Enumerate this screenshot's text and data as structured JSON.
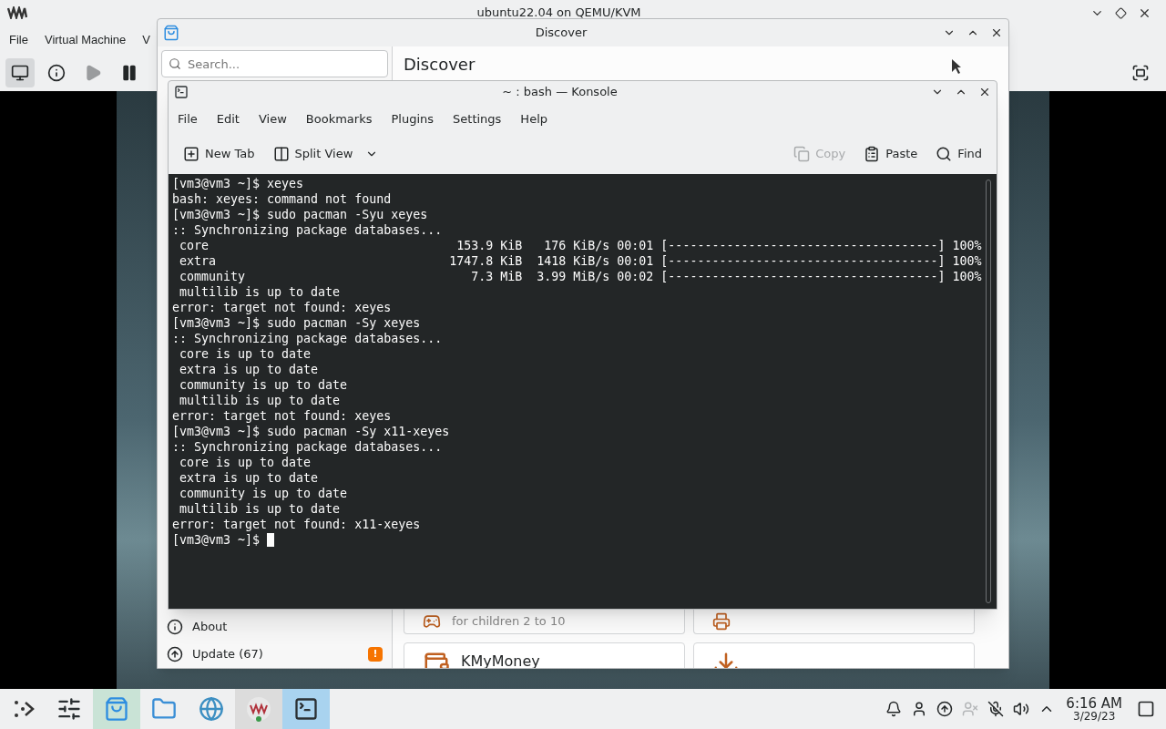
{
  "host_window": {
    "title": "ubuntu22.04 on QEMU/KVM",
    "menu": [
      "File",
      "Virtual Machine",
      "V"
    ],
    "toolbar": [
      {
        "kind": "console",
        "selected": true,
        "disabled": false
      },
      {
        "kind": "details",
        "selected": false,
        "disabled": false
      },
      {
        "kind": "run",
        "selected": false,
        "disabled": true
      },
      {
        "kind": "pause",
        "selected": false,
        "disabled": false
      }
    ]
  },
  "discover": {
    "title": "Discover",
    "search": {
      "placeholder": "Search..."
    },
    "heading": "Discover",
    "sidebar_items": [
      {
        "kind": "about",
        "label": "About"
      },
      {
        "kind": "update",
        "label": "Update (67)",
        "badge": "!"
      }
    ],
    "cards": [
      {
        "kind": "game",
        "subtitle": "for children 2 to 10"
      },
      {
        "kind": "printer"
      },
      {
        "kind": "money",
        "name": "KMyMoney"
      },
      {
        "kind": "download"
      }
    ]
  },
  "konsole": {
    "title": "~ : bash — Konsole",
    "menu": [
      "File",
      "Edit",
      "View",
      "Bookmarks",
      "Plugins",
      "Settings",
      "Help"
    ],
    "toolbar": [
      {
        "kind": "new-tab",
        "label": "New Tab",
        "disabled": false
      },
      {
        "kind": "split-view",
        "label": "Split View",
        "disabled": false
      },
      {
        "kind": "copy",
        "label": "Copy",
        "disabled": true
      },
      {
        "kind": "paste",
        "label": "Paste",
        "disabled": false
      },
      {
        "kind": "find",
        "label": "Find",
        "disabled": false
      }
    ],
    "lines": [
      "[vm3@vm3 ~]$ xeyes",
      "bash: xeyes: command not found",
      "[vm3@vm3 ~]$ sudo pacman -Syu xeyes",
      ":: Synchronizing package databases...",
      " core                                  153.9 KiB   176 KiB/s 00:01 [-------------------------------------] 100%",
      " extra                                1747.8 KiB  1418 KiB/s 00:01 [-------------------------------------] 100%",
      " community                               7.3 MiB  3.99 MiB/s 00:02 [-------------------------------------] 100%",
      " multilib is up to date",
      "error: target not found: xeyes",
      "[vm3@vm3 ~]$ sudo pacman -Sy xeyes",
      ":: Synchronizing package databases...",
      " core is up to date",
      " extra is up to date",
      " community is up to date",
      " multilib is up to date",
      "error: target not found: xeyes",
      "[vm3@vm3 ~]$ sudo pacman -Sy x11-xeyes",
      ":: Synchronizing package databases...",
      " core is up to date",
      " extra is up to date",
      " community is up to date",
      " multilib is up to date",
      "error: target not found: x11-xeyes",
      "[vm3@vm3 ~]$ "
    ]
  },
  "taskbar": {
    "tasks": [
      {
        "kind": "launcher",
        "open": false,
        "selected": false
      },
      {
        "kind": "settings",
        "open": false,
        "selected": false
      },
      {
        "kind": "discover",
        "open": true,
        "selected": false
      },
      {
        "kind": "files",
        "open": false,
        "selected": false
      },
      {
        "kind": "browser",
        "open": false,
        "selected": false
      },
      {
        "kind": "vm",
        "open": true,
        "selected": false
      },
      {
        "kind": "terminal",
        "open": true,
        "selected": true
      }
    ],
    "tray": [
      {
        "kind": "notifications",
        "disabled": false
      },
      {
        "kind": "user",
        "disabled": false
      },
      {
        "kind": "updates",
        "disabled": false
      },
      {
        "kind": "network-user",
        "disabled": true
      },
      {
        "kind": "mic-muted",
        "disabled": false
      },
      {
        "kind": "volume",
        "disabled": false
      },
      {
        "kind": "expand",
        "disabled": false
      }
    ],
    "clock": {
      "time": "6:16 AM",
      "date": "3/29/23"
    }
  }
}
